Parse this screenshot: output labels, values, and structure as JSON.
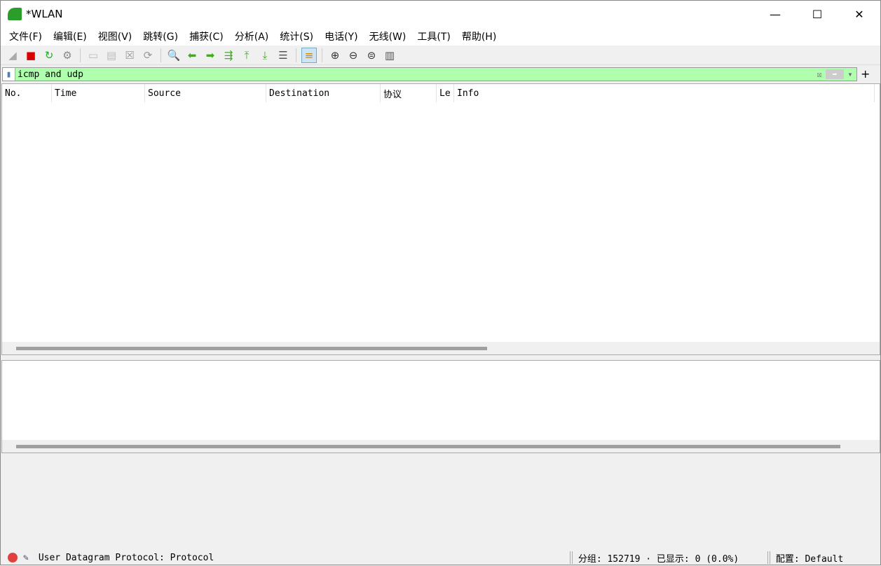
{
  "window": {
    "title": "*WLAN",
    "minimize": "—",
    "maximize": "☐",
    "close": "✕"
  },
  "menu": [
    "文件(F)",
    "编辑(E)",
    "视图(V)",
    "跳转(G)",
    "捕获(C)",
    "分析(A)",
    "统计(S)",
    "电话(Y)",
    "无线(W)",
    "工具(T)",
    "帮助(H)"
  ],
  "toolbar": [
    {
      "icon": "shark-fin-start-icon",
      "glyph": "◢",
      "color": "#aaaaaa"
    },
    {
      "icon": "stop-capture-icon",
      "glyph": "■",
      "color": "#dd0000"
    },
    {
      "icon": "restart-capture-icon",
      "glyph": "↻",
      "color": "#22aa22"
    },
    {
      "icon": "capture-options-icon",
      "glyph": "⚙",
      "color": "#888888"
    },
    {
      "sep": true
    },
    {
      "icon": "open-file-icon",
      "glyph": "▭",
      "color": "#bbbbbb"
    },
    {
      "icon": "save-file-icon",
      "glyph": "▤",
      "color": "#bbbbbb"
    },
    {
      "icon": "close-file-icon",
      "glyph": "☒",
      "color": "#999999"
    },
    {
      "icon": "reload-file-icon",
      "glyph": "⟳",
      "color": "#999999"
    },
    {
      "sep": true
    },
    {
      "icon": "find-packet-icon",
      "glyph": "🔍",
      "color": "#333333"
    },
    {
      "icon": "go-back-icon",
      "glyph": "⬅",
      "color": "#44aa22"
    },
    {
      "icon": "go-forward-icon",
      "glyph": "➡",
      "color": "#44aa22"
    },
    {
      "icon": "go-to-packet-icon",
      "glyph": "⇶",
      "color": "#44aa22"
    },
    {
      "icon": "first-packet-icon",
      "glyph": "⤒",
      "color": "#44aa22"
    },
    {
      "icon": "last-packet-icon",
      "glyph": "⤓",
      "color": "#44aa22"
    },
    {
      "icon": "autoscroll-icon",
      "glyph": "☰",
      "color": "#555555"
    },
    {
      "sep": true
    },
    {
      "icon": "colorize-icon",
      "glyph": "≡",
      "color": "#cc8800"
    },
    {
      "sep": true
    },
    {
      "icon": "zoom-in-icon",
      "glyph": "⊕",
      "color": "#333333"
    },
    {
      "icon": "zoom-out-icon",
      "glyph": "⊖",
      "color": "#333333"
    },
    {
      "icon": "zoom-normal-icon",
      "glyph": "⊜",
      "color": "#333333"
    },
    {
      "icon": "resize-columns-icon",
      "glyph": "▥",
      "color": "#555555"
    }
  ],
  "filter": {
    "value": "icmp and udp",
    "background": "#afffaf"
  },
  "columns": [
    {
      "label": "No.",
      "w": 71
    },
    {
      "label": "Time",
      "w": 133
    },
    {
      "label": "Source",
      "w": 173
    },
    {
      "label": "Destination",
      "w": 163
    },
    {
      "label": "协议",
      "w": 80
    },
    {
      "label": "Le",
      "w": 25
    },
    {
      "label": "Info",
      "w": 600
    }
  ],
  "status": {
    "message": "User Datagram Protocol: Protocol",
    "packets": "分组: 152719 · 已显示: 0 (0.0%)",
    "profile": "配置: Default"
  }
}
